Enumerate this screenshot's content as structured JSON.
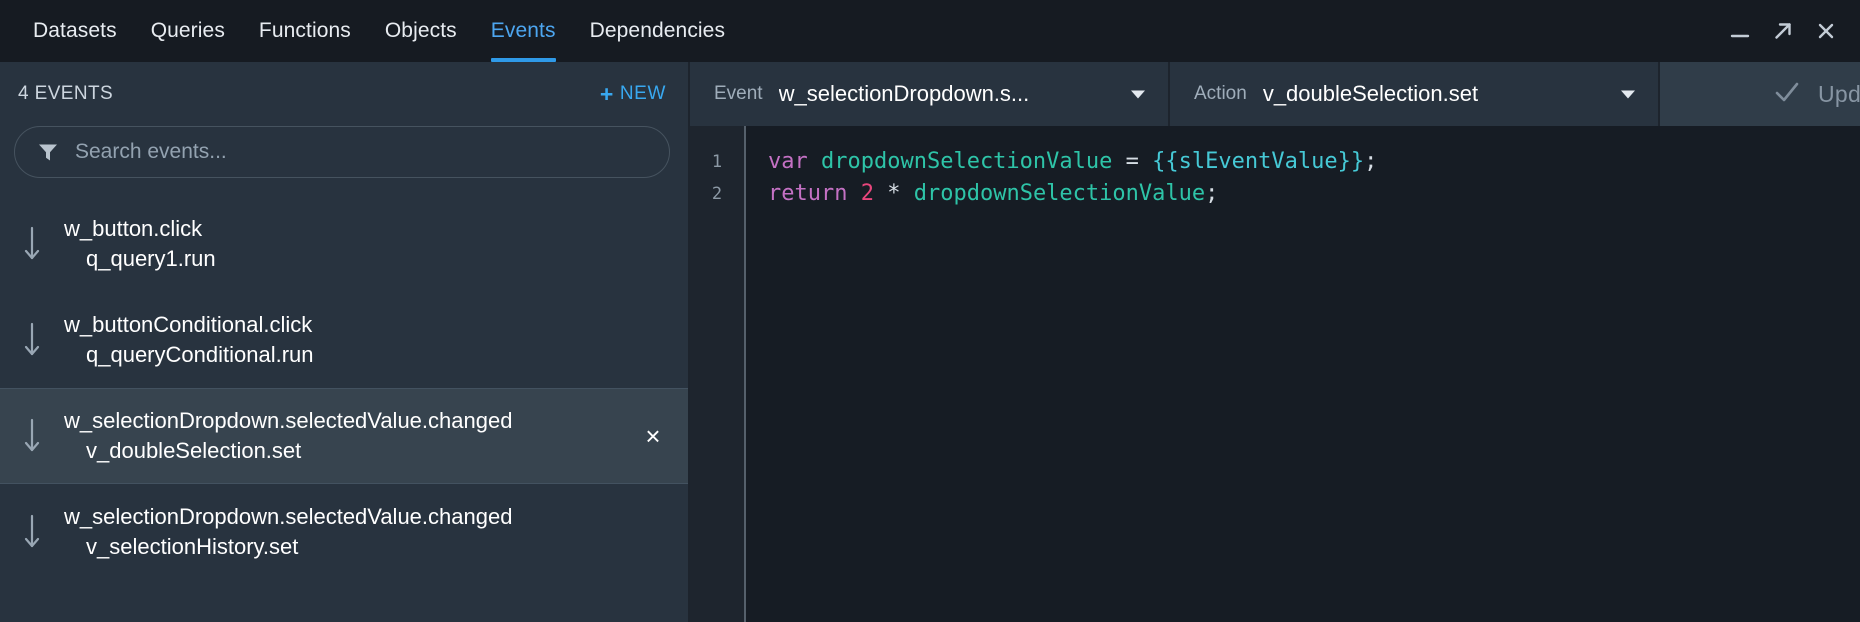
{
  "tabs": [
    {
      "label": "Datasets",
      "active": false
    },
    {
      "label": "Queries",
      "active": false
    },
    {
      "label": "Functions",
      "active": false
    },
    {
      "label": "Objects",
      "active": false
    },
    {
      "label": "Events",
      "active": true
    },
    {
      "label": "Dependencies",
      "active": false
    }
  ],
  "window_controls": [
    {
      "name": "minimize-icon",
      "glyph": "minimize"
    },
    {
      "name": "expand-icon",
      "glyph": "arrow-up-right"
    },
    {
      "name": "close-icon",
      "glyph": "close"
    }
  ],
  "sidebar": {
    "title": "4 EVENTS",
    "new_button": {
      "plus": "+",
      "label": "NEW"
    },
    "search": {
      "placeholder": "Search events...",
      "value": "",
      "icon": "filter-funnel-icon"
    },
    "events": [
      {
        "name": "w_button.click",
        "action": "q_query1.run",
        "selected": false,
        "icon": "arrow-down-icon"
      },
      {
        "name": "w_buttonConditional.click",
        "action": "q_queryConditional.run",
        "selected": false,
        "icon": "arrow-down-icon"
      },
      {
        "name": "w_selectionDropdown.selectedValue.changed",
        "action": "v_doubleSelection.set",
        "selected": true,
        "icon": "arrow-down-icon",
        "close_label": "×"
      },
      {
        "name": "w_selectionDropdown.selectedValue.changed",
        "action": "v_selectionHistory.set",
        "selected": false,
        "icon": "arrow-down-icon"
      }
    ]
  },
  "toolbar": {
    "event": {
      "label": "Event",
      "value": "w_selectionDropdown.s...",
      "caret": "▼"
    },
    "action": {
      "label": "Action",
      "value": "v_doubleSelection.set",
      "caret": "▼"
    },
    "updated": {
      "label": "Updated",
      "icon": "check-icon"
    }
  },
  "editor": {
    "line_numbers": [
      "1",
      "2"
    ],
    "lines": [
      [
        {
          "t": "var",
          "c": "kw"
        },
        {
          "t": " ",
          "c": "op"
        },
        {
          "t": "dropdownSelectionValue",
          "c": "id"
        },
        {
          "t": " = ",
          "c": "op"
        },
        {
          "t": "{{slEventValue}}",
          "c": "tpl"
        },
        {
          "t": ";",
          "c": "pun"
        }
      ],
      [
        {
          "t": "return",
          "c": "kw"
        },
        {
          "t": " ",
          "c": "op"
        },
        {
          "t": "2",
          "c": "num"
        },
        {
          "t": " * ",
          "c": "op"
        },
        {
          "t": "dropdownSelectionValue",
          "c": "id"
        },
        {
          "t": ";",
          "c": "pun"
        }
      ]
    ]
  },
  "colors": {
    "accent_blue": "#2f9ae8",
    "tab_active_text": "#4da6f0",
    "sidebar_bg": "#28333f",
    "selected_row_bg": "#37444f",
    "editor_bg": "#161c24",
    "keyword": "#c471c4",
    "identifier": "#2ec4a8",
    "template": "#46c9d6",
    "number": "#e8467c"
  }
}
